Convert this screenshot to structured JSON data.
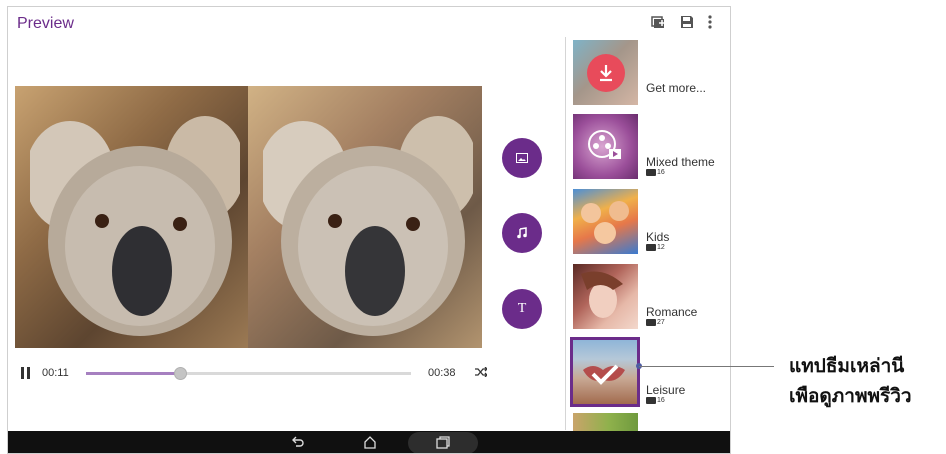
{
  "app": {
    "title": "Preview"
  },
  "actions": [
    {
      "icon": "add-album-icon"
    },
    {
      "icon": "save-icon"
    },
    {
      "icon": "more-vert-icon"
    }
  ],
  "player": {
    "current_time": "00:11",
    "total_time": "00:38",
    "progress": 0.29
  },
  "tool_buttons": [
    {
      "name": "image",
      "icon": "image-icon"
    },
    {
      "name": "music",
      "icon": "music-note-icon"
    },
    {
      "name": "text",
      "icon": "text-icon",
      "glyph": "T"
    }
  ],
  "themes": [
    {
      "label": "Get more...",
      "count": ""
    },
    {
      "label": "Mixed theme",
      "count": "16"
    },
    {
      "label": "Kids",
      "count": "12"
    },
    {
      "label": "Romance",
      "count": "27"
    },
    {
      "label": "Leisure",
      "count": "16",
      "selected": true
    },
    {
      "label": "",
      "count": ""
    }
  ],
  "callout": {
    "line1": "แทปธีมเหล่านี",
    "line2": "เพือดูภาพพรีวิว"
  },
  "colors": {
    "accent": "#6b2c8a",
    "download": "#e84b5b"
  }
}
